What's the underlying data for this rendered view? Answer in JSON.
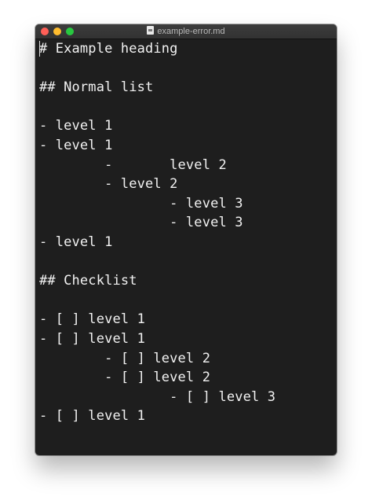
{
  "window": {
    "title": "example-error.md",
    "file_icon": "markdown-file-icon"
  },
  "editor": {
    "lines": [
      "# Example heading",
      "",
      "## Normal list",
      "",
      "- level 1",
      "- level 1",
      "        -       level 2",
      "        - level 2",
      "                - level 3",
      "                - level 3",
      "- level 1",
      "",
      "## Checklist",
      "",
      "- [ ] level 1",
      "- [ ] level 1",
      "        - [ ] level 2",
      "        - [ ] level 2",
      "                - [ ] level 3",
      "- [ ] level 1"
    ]
  }
}
